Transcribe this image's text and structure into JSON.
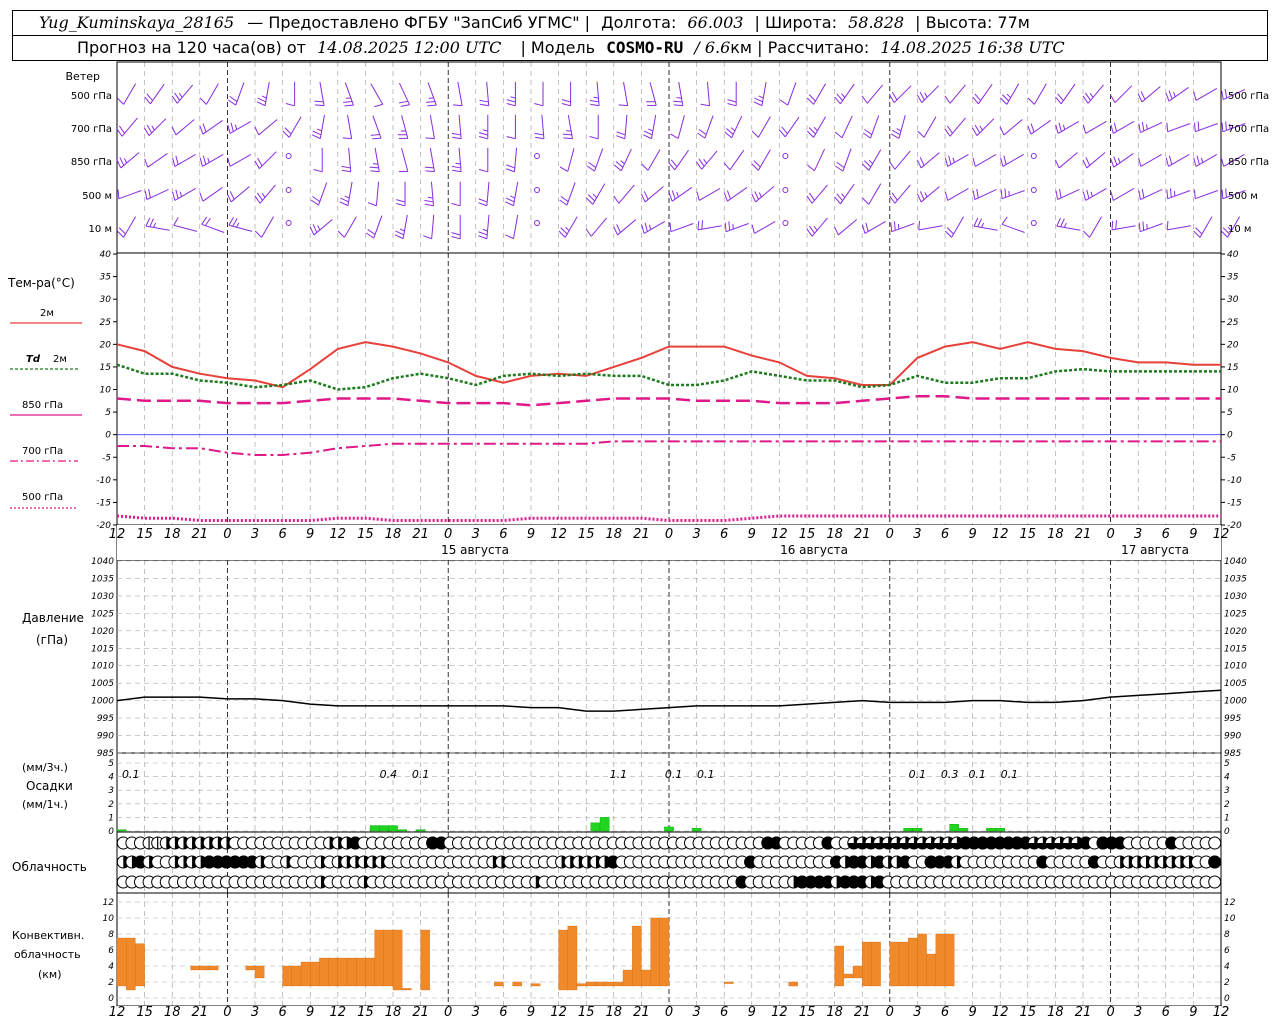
{
  "header": {
    "station": "Yug_Kuminskaya_28165",
    "provider": "— Предоставлено ФГБУ \"ЗапСиб УГМС\" |",
    "lon_label": "Долгота:",
    "lon_value": "66.003",
    "lat_label": "| Широта:",
    "lat_value": "58.828",
    "alt_label": "| Высота: 77м",
    "forecast_prefix": "Прогноз на 120 часа(ов) от",
    "forecast_time": "14.08.2025 12:00 UTC",
    "model_label": "| Модель",
    "model_name": "COSMO-RU",
    "model_res": "/ 6.6",
    "model_res_unit": "км | Рассчитано:",
    "calc_time": "14.08.2025 16:38 UTC"
  },
  "labels": {
    "wind": "Ветер",
    "wind_levels": [
      "500 гПа",
      "700 гПа",
      "850 гПа",
      "500 м",
      "10  м"
    ],
    "temp_title": "Тем-ра(°С)",
    "t2m": "2м",
    "td": "Td",
    "td2": "2м",
    "t850": "850 гПа",
    "t700": "700 гПа",
    "t500": "500 гПа",
    "pressure": "Давление",
    "pressure_unit": "(гПа)",
    "precip_unit3": "(мм/3ч.)",
    "precip": "Осадки",
    "precip_unit1": "(мм/1ч.)",
    "cloud": "Облачность",
    "conv1": "Конвективн.",
    "conv2": "облачность",
    "conv3": "(км)",
    "days": [
      "15 августа",
      "16 августа",
      "17 августа"
    ]
  },
  "colors": {
    "t2m": "#e8403a",
    "td": "#1e7a1e",
    "t850": "#e0198a",
    "t700": "#e0198a",
    "t500": "#e0198a",
    "pressure": "#000000",
    "precip": "#22d422",
    "conv": "#f0892a",
    "wind": "#8a2be2"
  },
  "chart_data": [
    {
      "type": "line",
      "name": "temperature",
      "x_hours": [
        0,
        3,
        6,
        9,
        12,
        15,
        18,
        21,
        24,
        27,
        30,
        33,
        36,
        39,
        42,
        45,
        48,
        51,
        54,
        57,
        60,
        63,
        66,
        69,
        72,
        75,
        78,
        81,
        84,
        87,
        90,
        93,
        96,
        99,
        102,
        105,
        108,
        111,
        114,
        117,
        120
      ],
      "tick_labels": [
        "12",
        "15",
        "18",
        "21",
        "0",
        "3",
        "6",
        "9",
        "12",
        "15",
        "18",
        "21",
        "0",
        "3",
        "6",
        "9",
        "12",
        "15",
        "18",
        "21",
        "0",
        "3",
        "6",
        "9",
        "12",
        "15",
        "18",
        "21",
        "0",
        "3",
        "6",
        "9",
        "12",
        "15",
        "18",
        "21",
        "0",
        "3",
        "6",
        "9",
        "12",
        "15",
        "18"
      ],
      "ylim": [
        -20,
        40
      ],
      "yticks": [
        40,
        35,
        30,
        25,
        20,
        15,
        10,
        5,
        0,
        -5,
        -10,
        -15,
        -20
      ],
      "series": [
        {
          "name": "2м",
          "values": [
            20,
            18.5,
            15,
            13.5,
            12.5,
            12,
            10.5,
            14.5,
            19,
            20.5,
            19.5,
            18,
            16,
            13,
            11.5,
            13,
            13.5,
            13,
            15,
            17,
            19.5,
            19.5,
            19.5,
            17.5,
            16,
            13,
            12.5,
            11,
            11,
            17,
            19.5,
            20.5,
            19,
            20.5,
            19,
            18.5,
            17,
            16,
            16,
            15.5,
            15.5
          ]
        },
        {
          "name": "Td 2м",
          "values": [
            15.5,
            13.5,
            13.5,
            12,
            11.5,
            10.5,
            11,
            12,
            10,
            10.5,
            12.5,
            13.5,
            12.5,
            11,
            13,
            13.5,
            13,
            13.5,
            13,
            13,
            11,
            11,
            12,
            14,
            13,
            12,
            12,
            10.5,
            11,
            13,
            11.5,
            11.5,
            12.5,
            12.5,
            14,
            14.5,
            14,
            14,
            14,
            14,
            14
          ]
        },
        {
          "name": "850 гПа",
          "values": [
            8,
            7.5,
            7.5,
            7.5,
            7,
            7,
            7,
            7.5,
            8,
            8,
            8,
            7.5,
            7,
            7,
            7,
            6.5,
            7,
            7.5,
            8,
            8,
            8,
            7.5,
            7.5,
            7.5,
            7,
            7,
            7,
            7.5,
            8,
            8.5,
            8.5,
            8,
            8,
            8,
            8,
            8,
            8,
            8,
            8,
            8,
            8
          ]
        },
        {
          "name": "700 гПа",
          "values": [
            -2.5,
            -2.5,
            -3,
            -3,
            -4,
            -4.5,
            -4.5,
            -4,
            -3,
            -2.5,
            -2,
            -2,
            -2,
            -2,
            -2,
            -2,
            -2,
            -2,
            -1.5,
            -1.5,
            -1.5,
            -1.5,
            -1.5,
            -1.5,
            -1.5,
            -1.5,
            -1.5,
            -1.5,
            -1.5,
            -1.5,
            -1.5,
            -1.5,
            -1.5,
            -1.5,
            -1.5,
            -1.5,
            -1.5,
            -1.5,
            -1.5,
            -1.5,
            -1.5
          ]
        },
        {
          "name": "500 гПа",
          "values": [
            -18,
            -18.5,
            -18.5,
            -19,
            -19,
            -19,
            -19,
            -19,
            -18.5,
            -18.5,
            -19,
            -19,
            -19,
            -19,
            -19,
            -18.5,
            -18.5,
            -18.5,
            -18.5,
            -18.5,
            -19,
            -19,
            -19,
            -18.5,
            -18,
            -18,
            -18,
            -18,
            -18,
            -18,
            -18,
            -18,
            -18,
            -18,
            -18,
            -18,
            -18,
            -18,
            -18,
            -18,
            -18
          ]
        }
      ]
    },
    {
      "type": "line",
      "name": "pressure",
      "x_hours": [
        0,
        3,
        6,
        9,
        12,
        15,
        18,
        21,
        24,
        27,
        30,
        33,
        36,
        39,
        42,
        45,
        48,
        51,
        54,
        57,
        60,
        63,
        66,
        69,
        72,
        75,
        78,
        81,
        84,
        87,
        90,
        93,
        96,
        99,
        102,
        105,
        108,
        111,
        114,
        117,
        120
      ],
      "ylim": [
        985,
        1040
      ],
      "yticks": [
        1040,
        1035,
        1030,
        1025,
        1020,
        1015,
        1010,
        1005,
        1000,
        995,
        990,
        985
      ],
      "series": [
        {
          "name": "Давление",
          "values": [
            1000,
            1001,
            1001,
            1001,
            1000.5,
            1000.5,
            1000,
            999,
            998.5,
            998.5,
            998.5,
            998.5,
            998.5,
            998.5,
            998.5,
            998,
            998,
            997,
            997,
            997.5,
            998,
            998.5,
            998.5,
            998.5,
            998.5,
            999,
            999.5,
            1000,
            999.5,
            999.5,
            999.5,
            1000,
            1000,
            999.5,
            999.5,
            1000,
            1001,
            1001.5,
            1002,
            1002.5,
            1003
          ]
        }
      ]
    },
    {
      "type": "bar",
      "name": "precipitation",
      "ylim": [
        0,
        5
      ],
      "yticks": [
        5,
        4,
        3,
        2,
        1,
        0
      ],
      "bars_mm_1h": [
        {
          "x": 0.5,
          "v": 0.1
        },
        {
          "x": 28,
          "v": 0.4
        },
        {
          "x": 29,
          "v": 0.4
        },
        {
          "x": 30,
          "v": 0.4
        },
        {
          "x": 31,
          "v": 0.1
        },
        {
          "x": 33,
          "v": 0.1
        },
        {
          "x": 52,
          "v": 0.6
        },
        {
          "x": 53,
          "v": 1.0
        },
        {
          "x": 60,
          "v": 0.3
        },
        {
          "x": 63,
          "v": 0.2
        },
        {
          "x": 86,
          "v": 0.2
        },
        {
          "x": 87,
          "v": 0.2
        },
        {
          "x": 91,
          "v": 0.5
        },
        {
          "x": 92,
          "v": 0.2
        },
        {
          "x": 95,
          "v": 0.2
        },
        {
          "x": 96,
          "v": 0.2
        }
      ],
      "labels_3h": [
        {
          "x": 1.5,
          "text": "0.1"
        },
        {
          "x": 29.5,
          "text": "0.4"
        },
        {
          "x": 33,
          "text": "0.1"
        },
        {
          "x": 54.5,
          "text": "1.1"
        },
        {
          "x": 60.5,
          "text": "0.1"
        },
        {
          "x": 64,
          "text": "0.1"
        },
        {
          "x": 87,
          "text": "0.1"
        },
        {
          "x": 90.5,
          "text": "0.3"
        },
        {
          "x": 93.5,
          "text": "0.1"
        },
        {
          "x": 97,
          "text": "0.1"
        }
      ]
    },
    {
      "type": "bar",
      "name": "convective cloudiness",
      "ylim": [
        0,
        13
      ],
      "yticks": [
        12,
        10,
        8,
        6,
        4,
        2,
        0
      ],
      "bars_km": [
        [
          0.5,
          1.5,
          7.5
        ],
        [
          1.5,
          1.0,
          7.5
        ],
        [
          2.5,
          1.5,
          6.8
        ],
        [
          8.5,
          3.5,
          4.0
        ],
        [
          9.5,
          3.5,
          4.0
        ],
        [
          10.5,
          3.5,
          4.0
        ],
        [
          14.5,
          3.5,
          4.0
        ],
        [
          15.5,
          2.5,
          4.0
        ],
        [
          18.5,
          1.5,
          4.0
        ],
        [
          19.5,
          1.5,
          4.0
        ],
        [
          20.5,
          1.5,
          4.5
        ],
        [
          21.5,
          1.5,
          4.5
        ],
        [
          22.5,
          1.5,
          5.0
        ],
        [
          23.5,
          1.5,
          5.0
        ],
        [
          24.5,
          1.5,
          5.0
        ],
        [
          25.5,
          1.5,
          5.0
        ],
        [
          26.5,
          1.5,
          5.0
        ],
        [
          27.5,
          1.5,
          5.0
        ],
        [
          28.5,
          1.5,
          8.5
        ],
        [
          29.5,
          1.5,
          8.5
        ],
        [
          30.5,
          1.0,
          8.5
        ],
        [
          31.5,
          1.0,
          1.2
        ],
        [
          33.5,
          1.0,
          8.5
        ],
        [
          41.5,
          1.5,
          2.0
        ],
        [
          43.5,
          1.5,
          2.0
        ],
        [
          45.5,
          1.5,
          1.8
        ],
        [
          48.5,
          1.0,
          8.5
        ],
        [
          49.5,
          1.0,
          9.0
        ],
        [
          50.5,
          1.5,
          1.8
        ],
        [
          51.5,
          1.5,
          2.0
        ],
        [
          52.5,
          1.5,
          2.0
        ],
        [
          53.5,
          1.5,
          2.0
        ],
        [
          54.5,
          1.5,
          2.0
        ],
        [
          55.5,
          1.5,
          3.5
        ],
        [
          56.5,
          1.5,
          9.0
        ],
        [
          57.5,
          1.5,
          3.5
        ],
        [
          58.5,
          1.5,
          10.0
        ],
        [
          59.5,
          1.5,
          10.0
        ],
        [
          66.5,
          1.8,
          2.0
        ],
        [
          73.5,
          1.5,
          2.0
        ],
        [
          78.5,
          1.5,
          6.5
        ],
        [
          79.5,
          2.5,
          3.0
        ],
        [
          80.5,
          2.5,
          4.0
        ],
        [
          81.5,
          1.5,
          7.0
        ],
        [
          82.5,
          1.5,
          7.0
        ],
        [
          84.5,
          1.5,
          7.0
        ],
        [
          85.5,
          1.5,
          7.0
        ],
        [
          86.5,
          1.5,
          7.5
        ],
        [
          87.5,
          1.5,
          8.0
        ],
        [
          88.5,
          1.5,
          5.5
        ],
        [
          89.5,
          1.5,
          8.0
        ],
        [
          90.5,
          1.5,
          8.0
        ]
      ]
    },
    {
      "type": "table",
      "name": "cloudiness",
      "rows": [
        "00011222222220000000000022240000000044000000000000000000000000000000000000044000004003333333333333444444443333334044400000400000",
        "22420022224444442002000202222220000000000002200000022222240000000000000004000000000424424224004442000000000400000400222222222004",
        "00000000000000000000000200002000000000000000000020000000000000000000000040000024444244424000000000000000000000000000000000000000"
      ]
    }
  ]
}
